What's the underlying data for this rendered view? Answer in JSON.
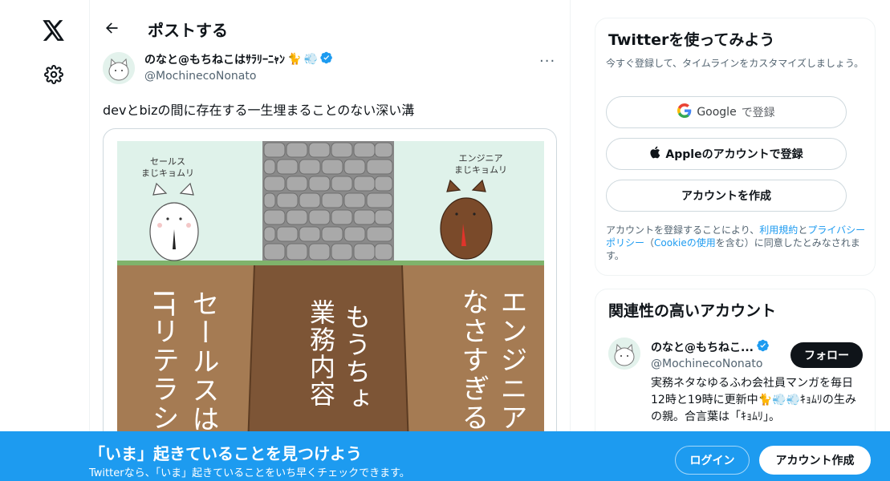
{
  "nav": {
    "logo": "x-logo-icon",
    "settings": "gear-icon"
  },
  "header": {
    "title": "ポストする"
  },
  "post": {
    "author_name": "のなと@もちねこはｻﾗﾘｰﾆｬﾝ",
    "author_handle": "@MochinecoNonato",
    "more": "···",
    "text": "devとbizの間に存在する一生埋まることのない深い溝",
    "image": {
      "left_caption": "セールス\nまじキョムリ",
      "right_caption": "エンジニア\nまじキョムリ",
      "left_text_col1": "セールスは",
      "left_text_col2": "ITリテラシ",
      "center_text_col1": "もうちょ",
      "center_text_col2": "業務内容",
      "right_text_col1": "エンジニア",
      "right_text_col2": "なさすぎる"
    }
  },
  "signup_card": {
    "title": "Twitterを使ってみよう",
    "subtitle": "今すぐ登録して、タイムラインをカスタマイズしましょう。",
    "google_label": "Google",
    "google_suffix": "で登録",
    "apple_label": "Appleのアカウントで登録",
    "create_label": "アカウントを作成",
    "legal_pre": "アカウントを登録することにより、",
    "legal_terms": "利用規約",
    "legal_and": "と",
    "legal_privacy": "プライバシーポリシー",
    "legal_open": "（",
    "legal_cookie": "Cookieの使用",
    "legal_post": "を含む）に同意したとみなされます。"
  },
  "related": {
    "title": "関連性の高いアカウント",
    "name": "のなと@もちねこ...",
    "handle": "@MochinecoNonato",
    "follow_label": "フォロー",
    "bio": "実務ネタなゆるふわ会社員マンガを毎日12時と19時に更新中🐈💨💨ｷｮﾑﾘの生みの親。合言葉は「ｷｮﾑﾘ」。"
  },
  "banner": {
    "title": "「いま」起きていることを見つけよう",
    "subtitle": "Twitterなら、「いま」起きていることをいち早くチェックできます。",
    "login_label": "ログイン",
    "signup_label": "アカウント作成"
  },
  "colors": {
    "accent": "#1d9bf0",
    "verified": "#1d9bf0",
    "dark": "#0f1419",
    "muted": "#536471"
  }
}
